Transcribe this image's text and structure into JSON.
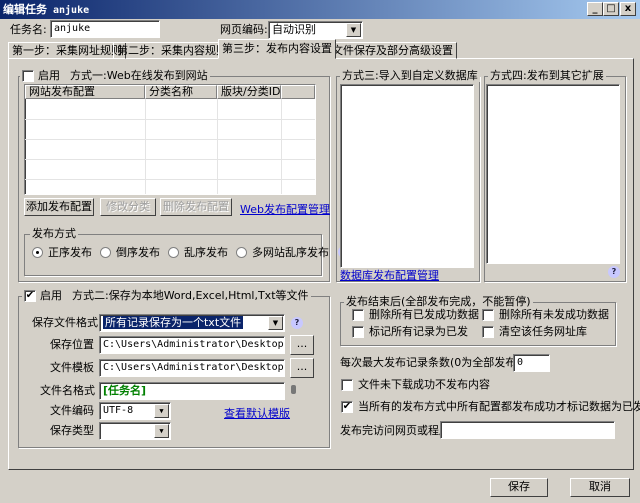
{
  "window": {
    "title": "编辑任务",
    "task": "anjuke",
    "minimize": "_",
    "maximize": "□",
    "close": "x"
  },
  "header": {
    "task_name_label": "任务名:",
    "task_name_value": "anjuke",
    "encoding_label": "网页编码:",
    "encoding_value": "自动识别"
  },
  "tabs": [
    {
      "label": "第一步：采集网址规则"
    },
    {
      "label": "第二步：采集内容规则"
    },
    {
      "label": "第三步：发布内容设置",
      "active": true
    },
    {
      "label": "文件保存及部分高级设置"
    }
  ],
  "method1": {
    "enable_label": "启用",
    "enabled": false,
    "title": "方式一:Web在线发布到网站",
    "columns": [
      "网站发布配置",
      "分类名称",
      "版块/分类ID"
    ],
    "rows": [],
    "buttons": {
      "add": "添加发布配置",
      "edit": "修改分类",
      "delete": "删除发布配置"
    },
    "manage_link": "Web发布配置管理",
    "publish_mode": {
      "title": "发布方式",
      "options": [
        "正序发布",
        "倒序发布",
        "乱序发布",
        "多网站乱序发布"
      ],
      "selected": "正序发布"
    }
  },
  "method3": {
    "title": "方式三:导入到自定义数据库",
    "manage_link": "数据库发布配置管理"
  },
  "method4": {
    "title": "方式四:发布到其它扩展"
  },
  "method2": {
    "enable_label": "启用",
    "enabled": true,
    "title": "方式二:保存为本地Word,Excel,Html,Txt等文件",
    "format_label": "保存文件格式",
    "format_value": "所有记录保存为一个txt文件",
    "location_label": "保存位置",
    "location_value": "C:\\Users\\Administrator\\Desktop",
    "template_label": "文件模板",
    "template_value": "C:\\Users\\Administrator\\Desktop\\anjuke",
    "filename_label": "文件名格式",
    "filename_value": "[任务名]",
    "encoding_label": "文件编码",
    "encoding_value": "UTF-8",
    "view_template_link": "查看默认模版",
    "type_label": "保存类型",
    "type_value": "",
    "browse": "..."
  },
  "after_publish": {
    "title": "发布结束后(全部发布完成，不能暂停)",
    "options": [
      {
        "label": "删除所有已发成功数据",
        "checked": false
      },
      {
        "label": "删除所有未发成功数据",
        "checked": false
      },
      {
        "label": "标记所有记录为已发",
        "checked": false
      },
      {
        "label": "清空该任务网址库",
        "checked": false
      }
    ]
  },
  "max_records": {
    "label": "每次最大发布记录条数(0为全部发布):",
    "value": "0"
  },
  "skip_failed": {
    "label": "文件未下载成功不发布内容",
    "checked": false
  },
  "mark_all": {
    "label": "当所有的发布方式中所有配置都发布成功才标记数据为已发",
    "checked": true
  },
  "visit_after": {
    "label": "发布完访问网页或程序",
    "value": ""
  },
  "footer": {
    "save": "保存",
    "cancel": "取消"
  },
  "colors": {
    "titlebar": "#0a246a",
    "face": "#d4d0c8",
    "link": "#0000cc",
    "selection": "#0a246a",
    "filename_text": "#008000"
  }
}
